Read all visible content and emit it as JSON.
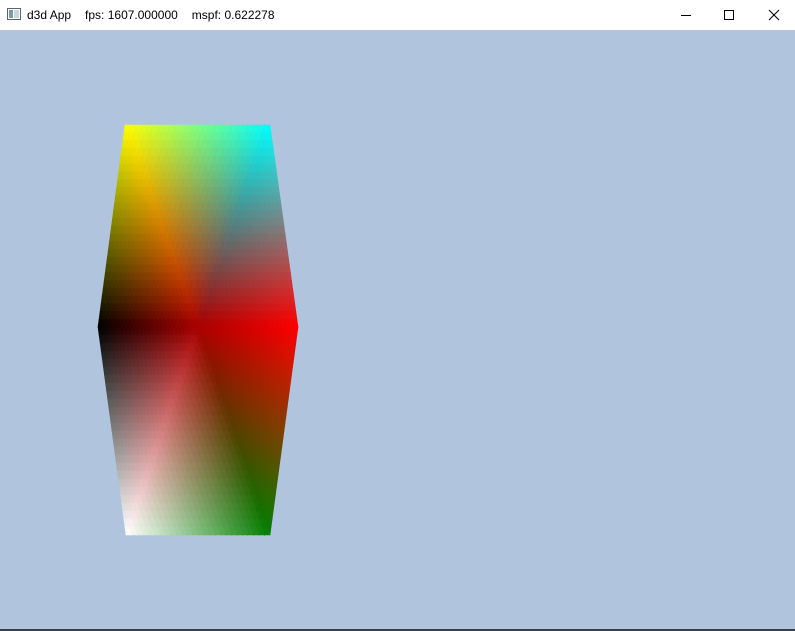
{
  "window": {
    "title": "d3d App",
    "fps": "fps: 1607.000000",
    "mspf": "mspf: 0.622278",
    "clear_color": "#b0c4de"
  },
  "caption_buttons": {
    "minimize": "minimize-icon",
    "maximize": "maximize-icon",
    "close": "close-icon"
  },
  "shape": {
    "vertex_colors": {
      "top_left": "#ffff00",
      "top_right": "#00ffff",
      "middle_left": "#000000",
      "center": "#aa0000",
      "middle_right": "#ff0000",
      "bottom_left": "#ffffff",
      "bottom_right": "#008000"
    }
  }
}
